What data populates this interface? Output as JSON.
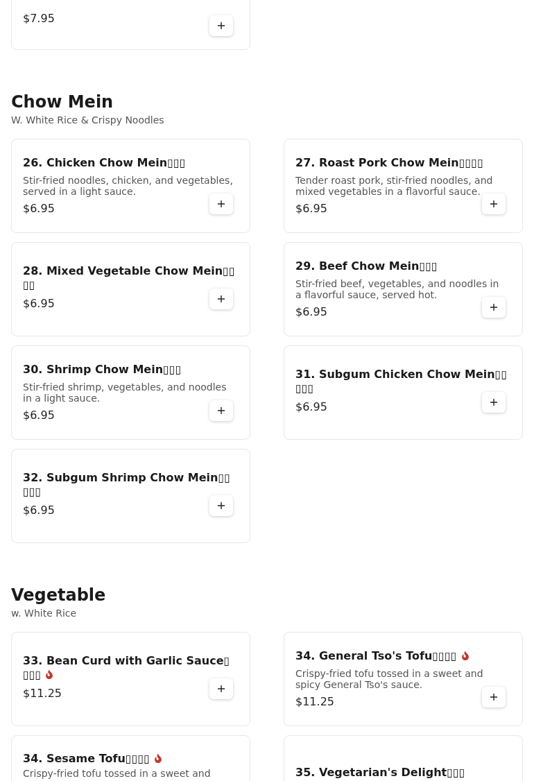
{
  "sections": [
    {
      "items": [
        {
          "price": "$7.95"
        }
      ]
    },
    {
      "title": "Chow Mein",
      "subtitle": "W. White Rice & Crispy Noodles",
      "items": [
        {
          "name": "26. Chicken Chow Mein▯▯▯",
          "description": "Stir-fried noodles, chicken, and vegetables, served in a light sauce.",
          "price": "$6.95",
          "spicy": false
        },
        {
          "name": "27. Roast Pork Chow Mein▯▯▯▯",
          "description": "Tender roast pork, stir-fried noodles, and mixed vegetables in a flavorful sauce.",
          "price": "$6.95",
          "spicy": false
        },
        {
          "name": "28. Mixed Vegetable Chow Mein▯▯▯▯",
          "price": "$6.95",
          "spicy": false
        },
        {
          "name": "29. Beef Chow Mein▯▯▯",
          "description": "Stir-fried beef, vegetables, and noodles in a flavorful sauce, served hot.",
          "price": "$6.95",
          "spicy": false
        },
        {
          "name": "30. Shrimp Chow Mein▯▯▯",
          "description": "Stir-fried shrimp, vegetables, and noodles in a light sauce.",
          "price": "$6.95",
          "spicy": false
        },
        {
          "name": "31. Subgum Chicken Chow Mein▯▯▯▯▯",
          "price": "$6.95",
          "spicy": false
        },
        {
          "name": "32. Subgum Shrimp Chow Mein▯▯▯▯▯",
          "price": "$6.95",
          "spicy": false
        }
      ]
    },
    {
      "title": "Vegetable",
      "subtitle": "w. White Rice",
      "items": [
        {
          "name": "33. Bean Curd with Garlic Sauce▯▯▯▯",
          "price": "$11.25",
          "spicy": true
        },
        {
          "name": "34. General Tso's Tofu▯▯▯▯",
          "description": "Crispy-fried tofu tossed in a sweet and spicy General Tso's sauce.",
          "price": "$11.25",
          "spicy": true
        },
        {
          "name": "34. Sesame Tofu▯▯▯▯",
          "description": "Crispy-fried tofu tossed in a sweet and",
          "spicy": true
        },
        {
          "name": "35. Vegetarian's Delight▯▯▯",
          "spicy": false
        }
      ]
    }
  ]
}
